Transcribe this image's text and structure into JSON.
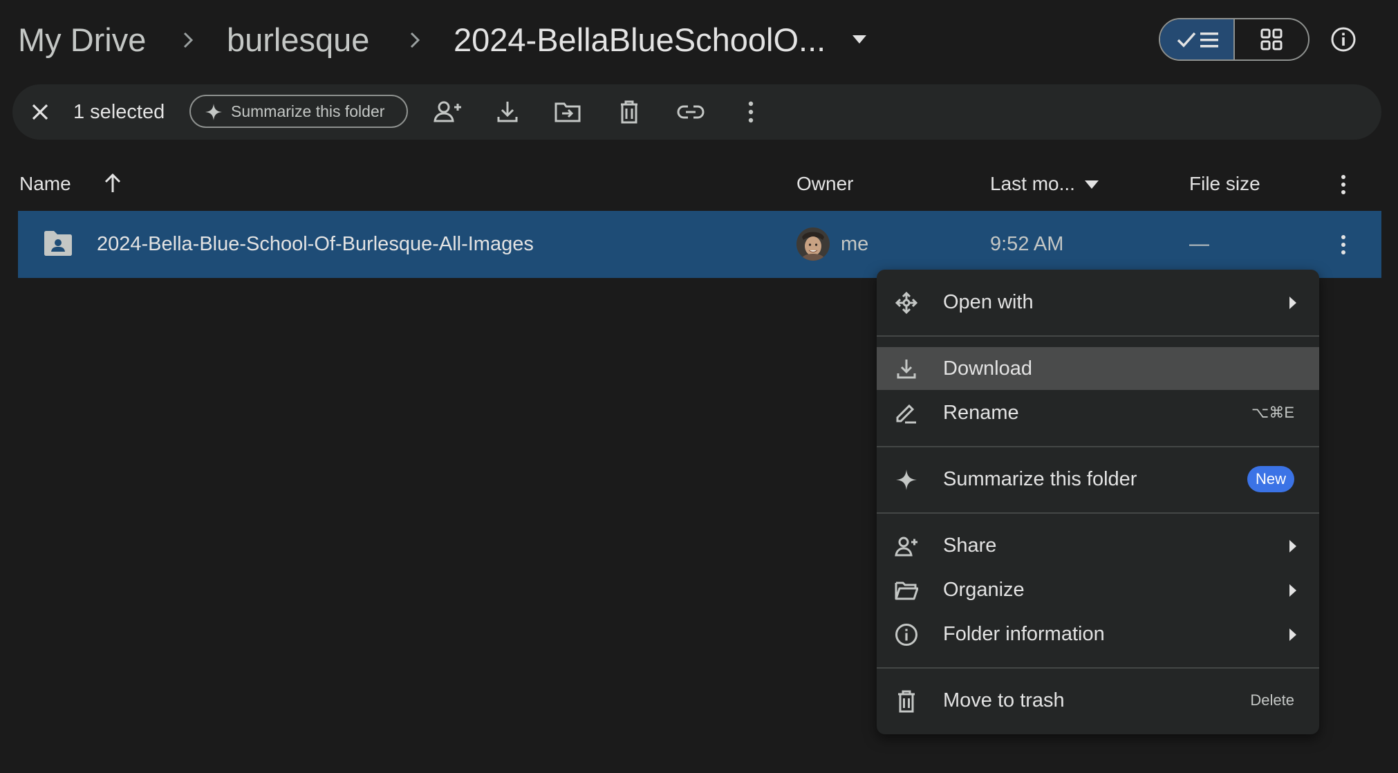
{
  "breadcrumb": {
    "root": "My Drive",
    "parent": "burlesque",
    "current": "2024-BellaBlueSchoolO..."
  },
  "toolbar": {
    "selected_count": "1 selected",
    "summarize_label": "Summarize this folder"
  },
  "columns": {
    "name": "Name",
    "owner": "Owner",
    "last_modified": "Last mo...",
    "file_size": "File size"
  },
  "row": {
    "name": "2024-Bella-Blue-School-Of-Burlesque-All-Images",
    "owner": "me",
    "modified": "9:52 AM",
    "size": "—"
  },
  "context_menu": {
    "open_with": "Open with",
    "download": "Download",
    "rename": "Rename",
    "rename_shortcut": "⌥⌘E",
    "summarize": "Summarize this folder",
    "summarize_badge": "New",
    "share": "Share",
    "organize": "Organize",
    "folder_info": "Folder information",
    "move_to_trash": "Move to trash",
    "trash_shortcut": "Delete"
  },
  "colors": {
    "background": "#1b1b1b",
    "selected_row": "#1e4c76",
    "menu_bg": "#242626",
    "menu_hover": "#4a4b4b",
    "accent_badge": "#3b73e6"
  }
}
